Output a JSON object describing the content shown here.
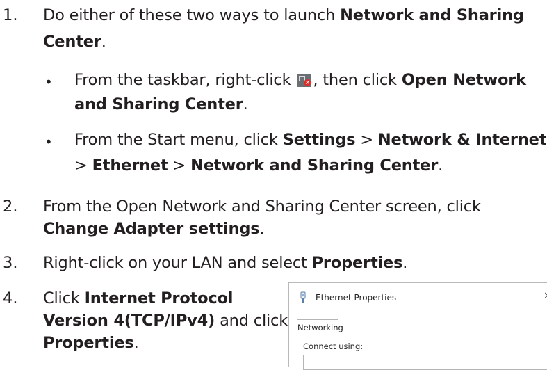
{
  "steps": {
    "s1": {
      "num": "1.",
      "pre": "Do either of these two ways to launch ",
      "bold1": "Network and Sharing",
      "bold2": "Center",
      "end": "."
    },
    "b1": {
      "pre": "From the taskbar, right-click ",
      "mid": ", then click ",
      "bold1": "Open Network",
      "bold2": "and Sharing Center",
      "end": "."
    },
    "b2": {
      "pre": "From the Start menu, click ",
      "bold1": "Settings",
      "gt1": " > ",
      "bold2": "Network & Internet",
      "gt2": "> ",
      "bold3": "Ethernet",
      "gt3": " > ",
      "bold4": "Network and Sharing Center",
      "end": "."
    },
    "s2": {
      "num": "2.",
      "line1": "From the Open Network and Sharing Center screen, click",
      "bold": "Change Adapter settings",
      "end": "."
    },
    "s3": {
      "num": "3.",
      "pre": "Right-click on your LAN and select ",
      "bold": "Properties",
      "end": "."
    },
    "s4": {
      "num": "4.",
      "pre": "Click ",
      "bold1": "Internet Protocol",
      "bold2": "Version 4(TCP/IPv4)",
      "mid": " and click",
      "bold3": "Properties",
      "end": "."
    }
  },
  "bullet_char": "•",
  "dialog": {
    "title": "Ethernet Properties",
    "close": "×",
    "tab": "Networking",
    "connect_label": "Connect using:"
  },
  "icons": {
    "tray": "network-error-tray-icon",
    "dialog": "ethernet-adapter-icon"
  },
  "colors": {
    "text": "#231f20",
    "error_badge": "#d9302c"
  }
}
